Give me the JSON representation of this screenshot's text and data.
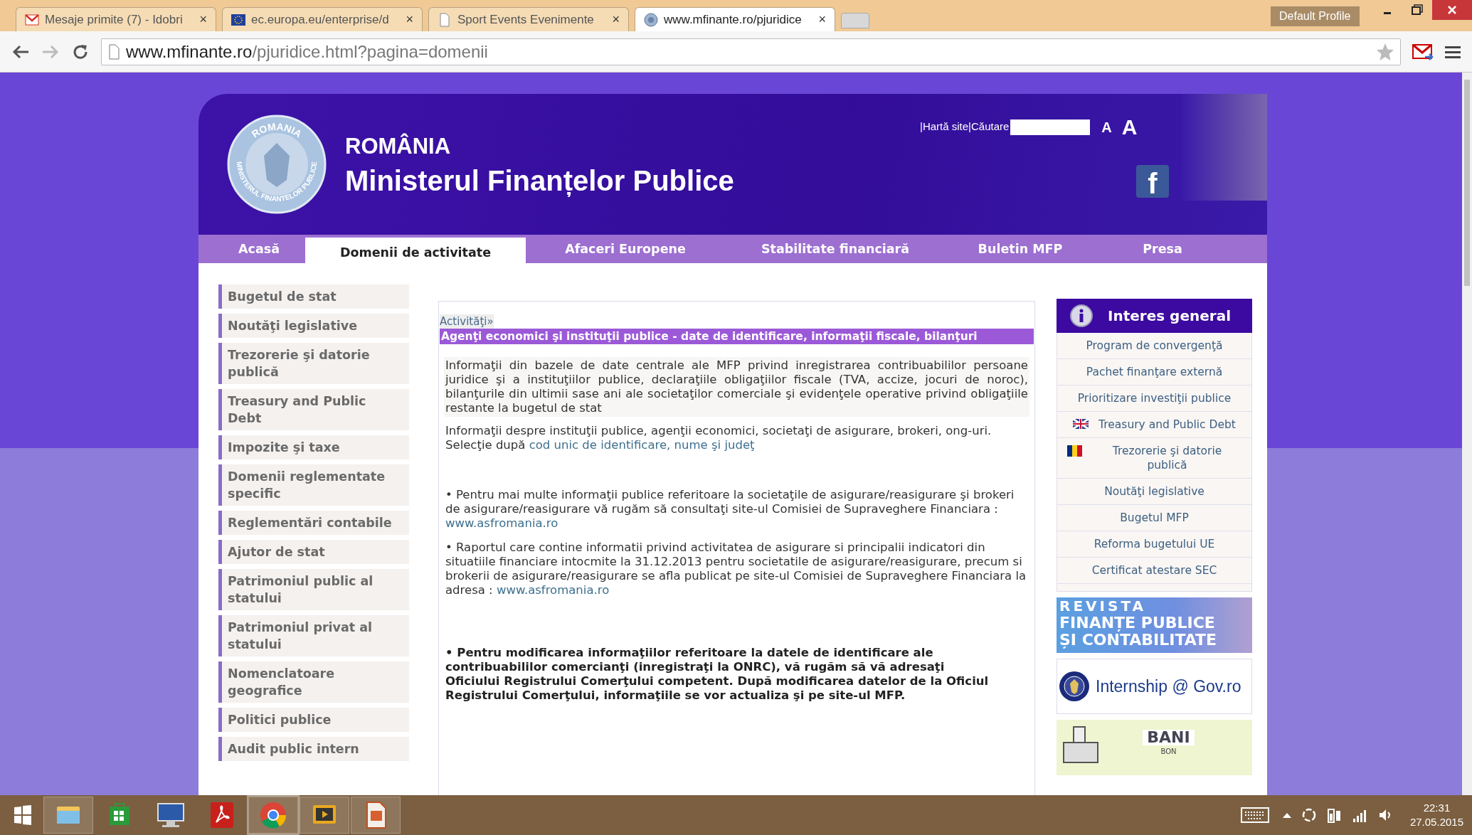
{
  "browser": {
    "tabs": [
      {
        "kind": "mail",
        "title": "Mesaje primite (7) - Idobri",
        "selected": false
      },
      {
        "kind": "eu",
        "title": "ec.europa.eu/enterprise/d",
        "selected": false
      },
      {
        "kind": "page",
        "title": "Sport Events Evenimente",
        "selected": false
      },
      {
        "kind": "site",
        "title": "www.mfinante.ro/pjuridice",
        "selected": true
      }
    ],
    "close": "×",
    "profile": "Default Profile",
    "url_host": "www.mfinante.ro",
    "url_path": "/pjuridice.html?pagina=domenii"
  },
  "header": {
    "seal_top": "ROMANIA",
    "seal_bottom": "MINISTERUL FINANTELOR PUBLICE",
    "country": "ROMÂNIA",
    "ministry": "Ministerul Finanțelor Publice",
    "links": [
      "|Hartă site",
      "|Căutare"
    ],
    "font_small": "A",
    "font_large": "A",
    "facebook": "f"
  },
  "nav": [
    {
      "label": "Acasă",
      "selected": false
    },
    {
      "label": "Domenii de activitate",
      "selected": true
    },
    {
      "label": "Afaceri Europene",
      "selected": false
    },
    {
      "label": "Stabilitate financiară",
      "selected": false
    },
    {
      "label": "Buletin MFP",
      "selected": false
    },
    {
      "label": "Presa",
      "selected": false
    }
  ],
  "sidebar": [
    "Bugetul de stat",
    "Noutăţi legislative",
    "Trezorerie şi datorie publică",
    "Treasury and Public Debt",
    "Impozite şi taxe",
    "Domenii reglementate specific",
    "Reglementări contabile",
    "Ajutor de stat",
    "Patrimoniul public al statului",
    "Patrimoniul privat al statului",
    "Nomenclatoare geografice",
    "Politici publice",
    "Audit public intern"
  ],
  "content": {
    "breadcrumb": "Activităţi»",
    "title": "Agenţi economici şi instituţii publice - date de identificare, informaţii fiscale, bilanţuri",
    "intro": "Informaţii din bazele de date centrale ale MFP privind inregistrarea contribuabililor persoane juridice şi a instituţiilor publice, declaraţiile obligaţiilor fiscale (TVA, accize, jocuri de noroc), bilanţurile din ultimii sase ani ale societaţilor comerciale şi evidenţele operative privind obligaţiile restante la bugetul de stat",
    "info": "Informaţii despre instituţii publice, agenţii economici, societaţi de asigurare, brokeri, ong-uri.",
    "selection": "Selecţie după",
    "selection_link": "cod unic de identificare, nume şi judeţ",
    "notes": [
      {
        "text": "• Pentru mai multe informaţii publice referitoare la societaţile de asigurare/reasigurare şi brokeri de asigurare/reasigurare vă rugăm să consultaţi site-ul Comisiei de Supraveghere Financiara :",
        "link": "www.asfromania.ro"
      },
      {
        "text": "• Raportul care contine informatii privind activitatea de asigurare si principalii indicatori din situatiile financiare intocmite la 31.12.2013 pentru societatile de asigurare/reasigurare, precum si brokerii de asigurare/reasigurare se afla publicat pe site-ul Comisiei de Supraveghere Financiara la adresa :",
        "link": "www.asfromania.ro"
      }
    ],
    "bold_note": "• Pentru modificarea informaţiilor referitoare la datele de identificare ale contribuabililor comercianţi (inregistraţi la ONRC), vă rugăm să vă adresaţi Oficiului Registrului Comerţului competent. După modificarea datelor de la Oficiul Registrului Comerţului, informaţiile se vor actualiza şi pe site-ul MFP."
  },
  "interest": {
    "title": "Interes general",
    "links": [
      {
        "label": "Program de convergenţă",
        "kind": "plain"
      },
      {
        "label": "Pachet finanţare externă",
        "kind": "plain"
      },
      {
        "label": "Prioritizare investiţii publice",
        "kind": "plain"
      },
      {
        "label": "Treasury and Public Debt",
        "kind": "english"
      },
      {
        "label": "Trezorerie şi datorie publică",
        "kind": "romanian"
      },
      {
        "label": "Noutăţi legislative",
        "kind": "plain"
      },
      {
        "label": "Bugetul MFP",
        "kind": "plain"
      },
      {
        "label": "Reforma bugetului UE",
        "kind": "plain"
      },
      {
        "label": "Certificat atestare SEC",
        "kind": "plain"
      }
    ]
  },
  "banners": [
    {
      "kind": "revista",
      "lines": [
        "REVISTA",
        "FINANȚE PUBLICE",
        "ȘI CONTABILITATE"
      ]
    },
    {
      "kind": "internship",
      "lines": [
        "Internship @ Gov.ro"
      ]
    },
    {
      "kind": "bani",
      "lines": [
        "BANI",
        "BON"
      ]
    }
  ],
  "taskbar": {
    "apps": [
      {
        "kind": "explorer",
        "running": true,
        "selected": false
      },
      {
        "kind": "store",
        "running": false,
        "selected": false
      },
      {
        "kind": "monitor",
        "running": false,
        "selected": false
      },
      {
        "kind": "pdf",
        "running": false,
        "selected": false
      },
      {
        "kind": "chrome",
        "running": true,
        "selected": true
      },
      {
        "kind": "player",
        "running": true,
        "selected": false
      },
      {
        "kind": "document",
        "running": true,
        "selected": false
      }
    ],
    "time": "22:31",
    "date": "27.05.2015"
  }
}
